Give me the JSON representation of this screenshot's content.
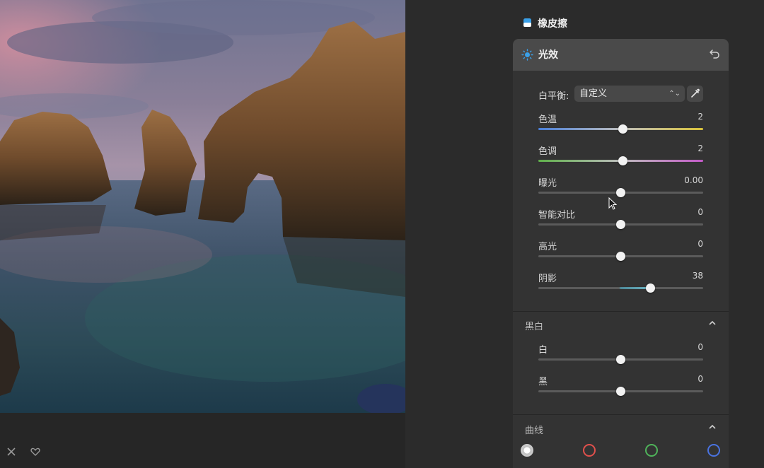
{
  "panel_tool": {
    "label": "橡皮擦",
    "icon": "eraser-icon"
  },
  "light_panel": {
    "title": "光效",
    "icon": "sun-icon",
    "undo_icon": "undo-icon",
    "white_balance": {
      "label": "白平衡:",
      "value": "自定义",
      "picker_icon": "eyedropper-icon"
    },
    "sliders": [
      {
        "name": "色温",
        "value": "2"
      },
      {
        "name": "色调",
        "value": "2"
      },
      {
        "name": "曝光",
        "value": "0.00"
      },
      {
        "name": "智能对比",
        "value": "0"
      },
      {
        "name": "高光",
        "value": "0"
      },
      {
        "name": "阴影",
        "value": "38"
      }
    ]
  },
  "bw_section": {
    "title": "黑白",
    "sliders": [
      {
        "name": "白",
        "value": "0"
      },
      {
        "name": "黑",
        "value": "0"
      }
    ]
  },
  "curves_section": {
    "title": "曲线",
    "channels": [
      "white",
      "red",
      "green",
      "blue"
    ],
    "colors": {
      "white": "#dcdcdc",
      "red": "#e0504c",
      "green": "#4fb35a",
      "blue": "#4a73e0"
    }
  },
  "bottom_bar": {
    "close_icon": "close-icon",
    "heart_icon": "heart-icon"
  }
}
